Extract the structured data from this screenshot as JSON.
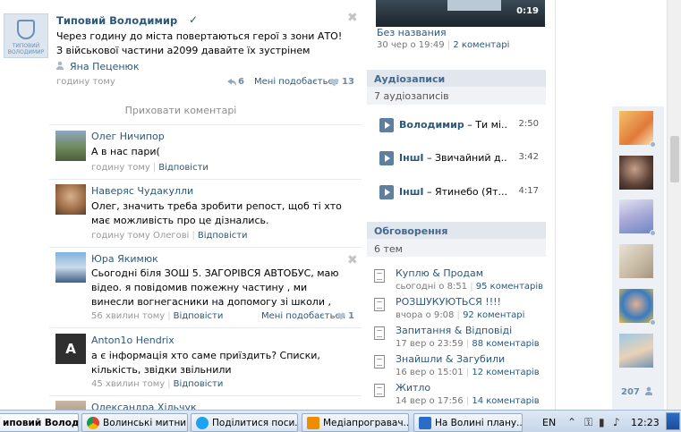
{
  "post": {
    "author": "Типовий Володимир",
    "verified_mark": "✓",
    "emblem_text": "ТИПОВИЙ ВОЛОДИМИР",
    "text": "Через годину до міста повертаються герої з зони АТО! З військової частини а2099 давайте їх зустрінем",
    "signer": "Яна Пеценюк",
    "time": "годину тому",
    "reposts": "6",
    "like_label": "Мені подобається",
    "likes": "13"
  },
  "hide_comments_label": "Приховати коментарі",
  "comments": [
    {
      "name": "Олег Ничипор",
      "text": "А в нас пари(",
      "time": "годину тому",
      "reply": "Відповісти"
    },
    {
      "name": "Наверяс Чудакулли",
      "text": "Олег, значить треба зробити репост, щоб ті хто має можливість про це дізнались.",
      "time": "годину тому Олегові",
      "reply": "Відповісти"
    },
    {
      "name": "Юра Якимюк",
      "text": "Сьогодні біля ЗОШ 5. ЗАГОРІВСЯ АВТОБУС, маю відео. я повідомив пожежну частину , ми винесли вогнегасники на допомогу зі школи ,",
      "time": "56 хвилин тому",
      "reply": "Відповісти",
      "like_label": "Мені подобається",
      "likes": "1"
    },
    {
      "name": "Anton1o Hendrix",
      "avatar_letter": "A",
      "text": "а є інформація хто саме приїздить? Списки, кількість, звідки звільнили",
      "time": "45 хвилин тому",
      "reply": "Відповісти"
    },
    {
      "name": "Олександра Хільчук"
    }
  ],
  "video": {
    "duration": "0:19",
    "title": "Без названия",
    "date": "30 чер о 19:49",
    "comments_link": "2 коментарі"
  },
  "audio": {
    "header": "Аудіозаписи",
    "count": "7 аудіозаписів",
    "tracks": [
      {
        "artist": "Володимир",
        "title": " – Ти мі...",
        "duration": "2:50"
      },
      {
        "artist": "ІншІ",
        "title": " – Звичайний д...",
        "duration": "3:42"
      },
      {
        "artist": "ІншІ",
        "title": " – Ятинебо (Ят...",
        "duration": "4:17"
      }
    ]
  },
  "topics": {
    "header": "Обговорення",
    "count": "6 тем",
    "items": [
      {
        "title": "Куплю & Продам",
        "date": "сьогодні о 8:51",
        "comments": "95 коментарів"
      },
      {
        "title": "РОЗШУКУЮТЬСЯ !!!!",
        "date": "вчора о 9:08",
        "comments": "92 коментарі"
      },
      {
        "title": "Запитання & Відповіді",
        "date": "17 вер о 23:59",
        "comments": "88 коментарів"
      },
      {
        "title": "Знайшли & Загубили",
        "date": "16 вер о 15:01",
        "comments": "12 коментарів"
      },
      {
        "title": "Житло",
        "date": "14 вер о 17:56",
        "comments": "14 коментарів"
      }
    ]
  },
  "friends": {
    "count": "207"
  },
  "taskbar": {
    "tasks": [
      {
        "label": "иповий Волод...",
        "color": "#4a76a8"
      },
      {
        "label": "Волинські митни...",
        "color": "#e8a317"
      },
      {
        "label": "Поділитися поси...",
        "color": "#1da1f2"
      },
      {
        "label": "Медіапрогравач...",
        "color": "#f08c00"
      },
      {
        "label": "На Волині плану...",
        "color": "#2b6cc4"
      }
    ],
    "language": "EN",
    "time": "12:23"
  },
  "colors": {
    "link": "#2b587a",
    "section_bg": "#e1e7ed",
    "accent": "#45688e"
  }
}
